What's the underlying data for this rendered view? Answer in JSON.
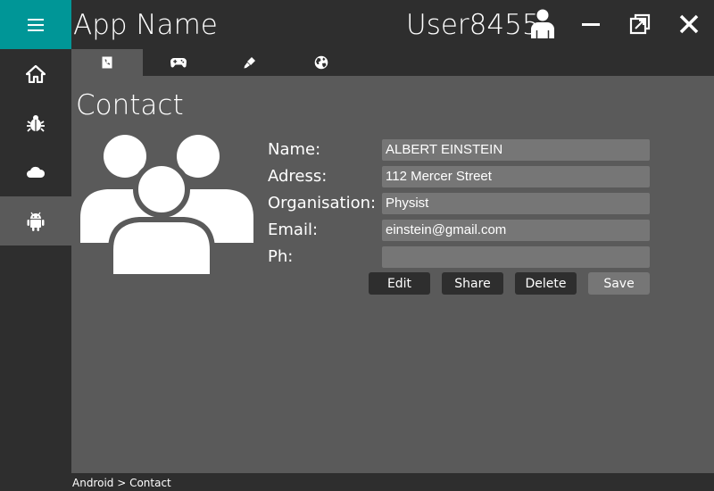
{
  "app": {
    "title": "App Name",
    "username": "User8455"
  },
  "colors": {
    "accent": "#009697",
    "chrome": "#2e2e2e",
    "content": "#5a5a5a",
    "field": "#767676"
  },
  "sidebar": {
    "menu_icon": "hamburger-menu-icon",
    "items": [
      {
        "name": "home",
        "icon": "home-icon"
      },
      {
        "name": "bug",
        "icon": "bug-icon"
      },
      {
        "name": "cloud",
        "icon": "cloud-icon"
      },
      {
        "name": "android",
        "icon": "android-icon",
        "active": true
      }
    ]
  },
  "window_controls": {
    "minimize": "minimize-icon",
    "restore": "restore-icon",
    "close": "close-icon"
  },
  "tabs": [
    {
      "icon": "phone-book-icon",
      "active": true
    },
    {
      "icon": "gamepad-icon"
    },
    {
      "icon": "brush-icon"
    },
    {
      "icon": "globe-icon"
    }
  ],
  "contact": {
    "title": "Contact",
    "labels": {
      "name": "Name:",
      "address": "Adress:",
      "organisation": "Organisation:",
      "email": "Email:",
      "phone": "Ph:"
    },
    "values": {
      "name": "ALBERT EINSTEIN",
      "address": "112 Mercer Street",
      "organisation": "Physist",
      "email": "einstein@gmail.com",
      "phone": ""
    }
  },
  "actions": {
    "edit": "Edit",
    "share": "Share",
    "delete": "Delete",
    "save": "Save"
  },
  "breadcrumb": {
    "text": "Android > Contact"
  }
}
